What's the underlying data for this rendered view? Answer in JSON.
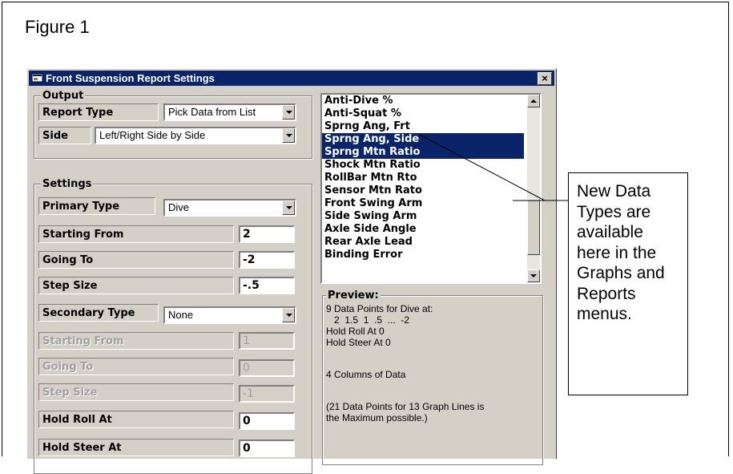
{
  "figure": {
    "title": "Figure 1"
  },
  "window": {
    "title": "Front Suspension Report Settings",
    "close_symbol": "×",
    "icon": "window-app-icon"
  },
  "output": {
    "group_label": "Output",
    "report_type_label": "Report Type",
    "report_type_value": "Pick Data from List",
    "side_label": "Side",
    "side_value": "Left/Right Side by Side"
  },
  "settings": {
    "group_label": "Settings",
    "primary_type_label": "Primary Type",
    "primary_type_value": "Dive",
    "starting_from_label": "Starting From",
    "starting_from_value": "2",
    "going_to_label": "Going To",
    "going_to_value": "-2",
    "step_size_label": "Step Size",
    "step_size_value": "-.5",
    "secondary_type_label": "Secondary Type",
    "secondary_type_value": "None",
    "sec_starting_from_label": "Starting From",
    "sec_starting_from_value": "1",
    "sec_going_to_label": "Going To",
    "sec_going_to_value": "0",
    "sec_step_size_label": "Step Size",
    "sec_step_size_value": "-1",
    "hold_roll_label": "Hold Roll At",
    "hold_roll_value": "0",
    "hold_steer_label": "Hold Steer At",
    "hold_steer_value": "0"
  },
  "data_list": {
    "items": [
      {
        "label": "Anti-Dive %",
        "selected": false
      },
      {
        "label": "Anti-Squat %",
        "selected": false
      },
      {
        "label": "Sprng Ang, Frt",
        "selected": false
      },
      {
        "label": "Sprng Ang, Side",
        "selected": true
      },
      {
        "label": "Sprng Mtn Ratio",
        "selected": true
      },
      {
        "label": "Shock Mtn Ratio",
        "selected": false
      },
      {
        "label": "RollBar Mtn Rto",
        "selected": false
      },
      {
        "label": "Sensor Mtn Rato",
        "selected": false
      },
      {
        "label": "Front Swing Arm",
        "selected": false
      },
      {
        "label": "Side Swing Arm",
        "selected": false
      },
      {
        "label": "Axle Side Angle",
        "selected": false
      },
      {
        "label": "Rear Axle Lead",
        "selected": false
      },
      {
        "label": "Binding Error",
        "selected": false
      }
    ]
  },
  "preview": {
    "group_label": "Preview:",
    "line1": "9 Data Points for Dive at:",
    "line2": "2  1.5  1  .5  ...  -2",
    "line3": "Hold Roll At 0",
    "line4": "Hold Steer At 0",
    "line5": "4 Columns of Data",
    "line6": "(21 Data Points for 13 Graph Lines is",
    "line7": "the Maximum possible.)"
  },
  "callout": {
    "text": "New Data Types are available here in the Graphs and Reports menus."
  }
}
